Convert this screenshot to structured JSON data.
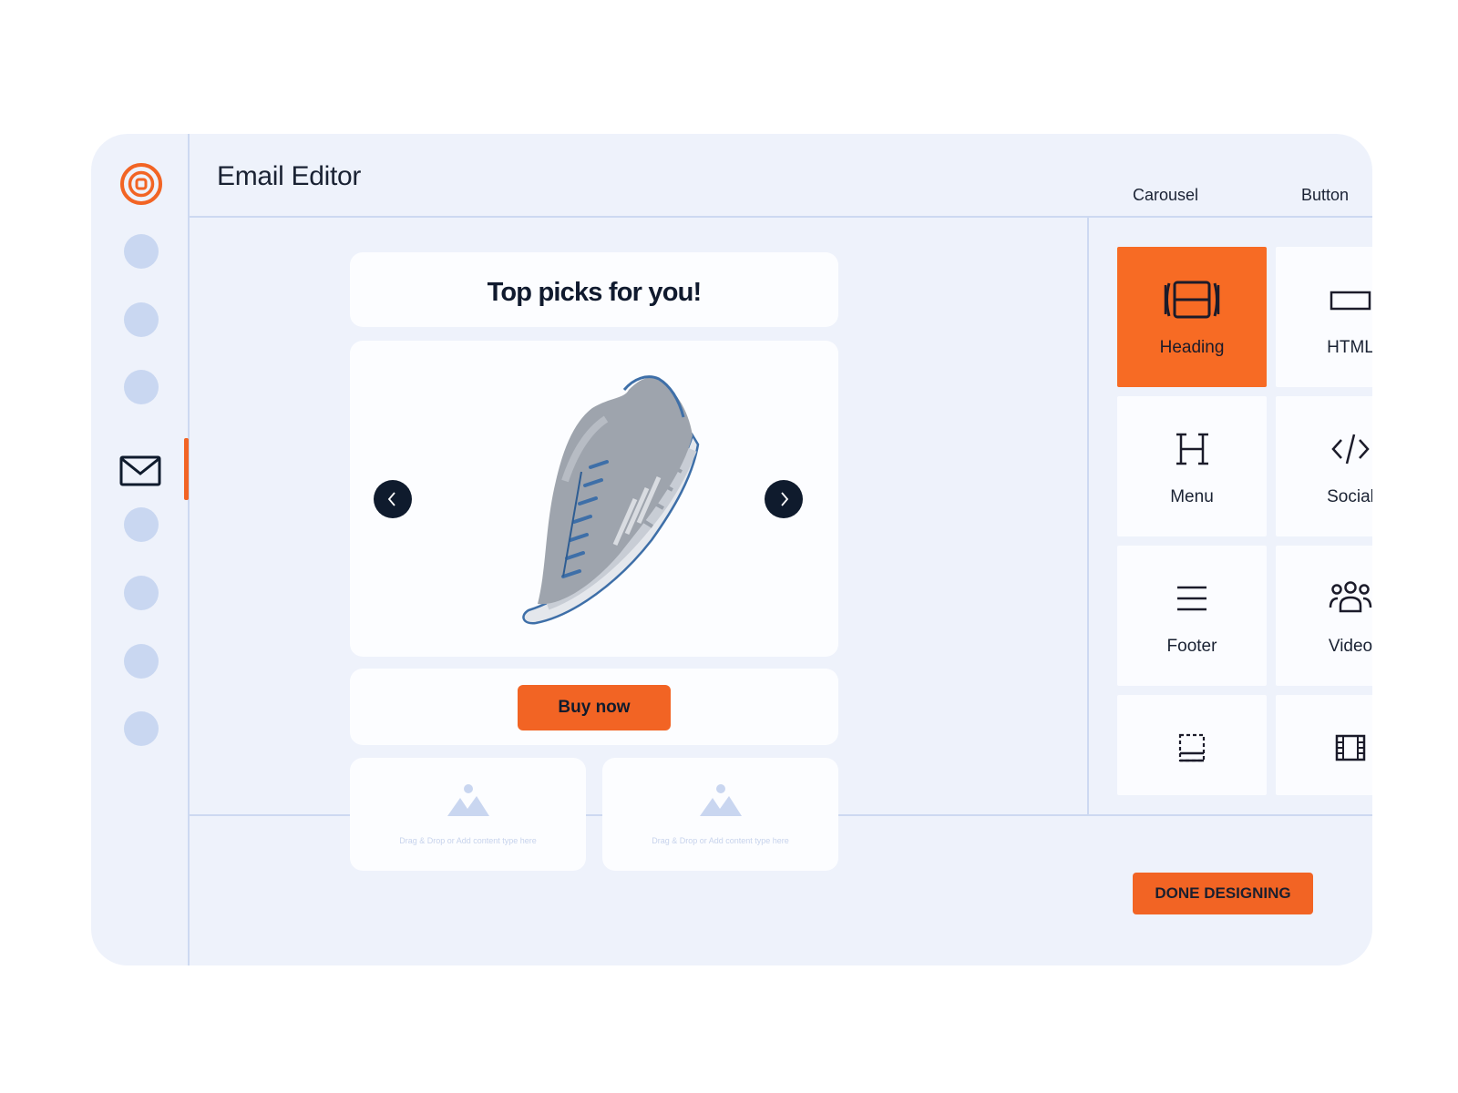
{
  "app": {
    "title": "Email Editor"
  },
  "tabs": [
    {
      "label": "Carousel"
    },
    {
      "label": "Button"
    }
  ],
  "canvas": {
    "heading": "Top picks for you!",
    "carousel": {
      "image": "running-shoe-image",
      "prev_icon": "chevron-left-icon",
      "next_icon": "chevron-right-icon"
    },
    "cta_label": "Buy now",
    "drop_zones": [
      {
        "text": "Drag & Drop or Add content type here",
        "icon": "image-placeholder-icon"
      },
      {
        "text": "Drag & Drop or Add content type here",
        "icon": "image-placeholder-icon"
      }
    ]
  },
  "blocks": [
    {
      "label": "Heading",
      "icon": "carousel-icon",
      "active": true
    },
    {
      "label": "HTML",
      "icon": "button-icon",
      "active": false
    },
    {
      "label": "Menu",
      "icon": "heading-icon",
      "active": false
    },
    {
      "label": "Social",
      "icon": "code-icon",
      "active": false
    },
    {
      "label": "Footer",
      "icon": "menu-icon",
      "active": false
    },
    {
      "label": "Video",
      "icon": "people-icon",
      "active": false
    },
    {
      "label": "",
      "icon": "footer-icon",
      "active": false
    },
    {
      "label": "",
      "icon": "film-icon",
      "active": false
    }
  ],
  "actions": {
    "done_label": "DONE DESIGNING"
  },
  "colors": {
    "accent": "#f26424",
    "background": "#eef2fb",
    "rail_dot": "#c9d7f1",
    "dark": "#0f1b2d"
  }
}
